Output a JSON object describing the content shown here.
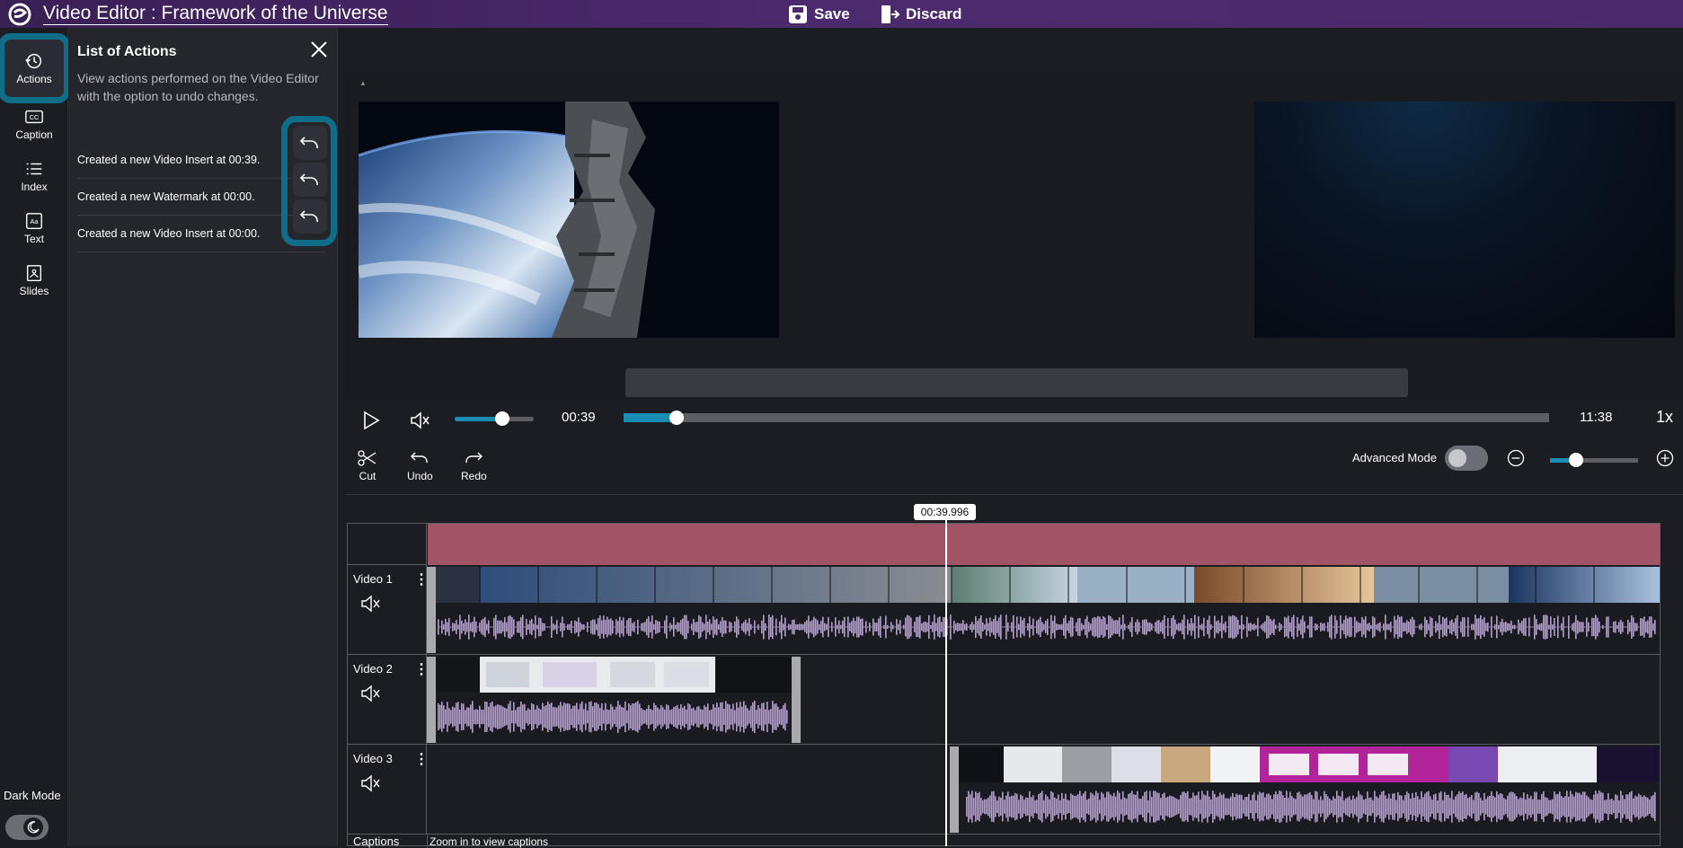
{
  "header": {
    "title": "Video Editor : Framework of the Universe",
    "save_label": "Save",
    "discard_label": "Discard"
  },
  "sidebar": {
    "items": [
      {
        "label": "Actions",
        "icon": "history-icon",
        "active": true
      },
      {
        "label": "Caption",
        "icon": "cc-icon"
      },
      {
        "label": "Index",
        "icon": "list-icon"
      },
      {
        "label": "Text",
        "icon": "text-icon"
      },
      {
        "label": "Slides",
        "icon": "slides-icon"
      }
    ],
    "dark_mode_label": "Dark Mode"
  },
  "actions_panel": {
    "title": "List of Actions",
    "description": "View actions performed on the Video Editor with the option to undo changes.",
    "actions": [
      "Created a new Video Insert at 00:39.",
      "Created a new Watermark at 00:00.",
      "Created a new Video Insert at 00:00."
    ]
  },
  "player": {
    "current_time": "00:39",
    "total_time": "11:38",
    "speed": "1x",
    "volume_level": 0.6,
    "progress": 0.057
  },
  "tools": {
    "cut": "Cut",
    "undo": "Undo",
    "redo": "Redo",
    "advanced_mode": "Advanced Mode",
    "zoom_level": 0.3
  },
  "timeline": {
    "playhead_time": "00:39.996",
    "tracks": [
      {
        "name": "Video 1"
      },
      {
        "name": "Video 2"
      },
      {
        "name": "Video 3"
      }
    ],
    "captions_label": "Captions",
    "captions_hint": "Zoom in to view captions"
  },
  "colors": {
    "accent": "#1a8db5",
    "highlight": "#0f6d8a",
    "ruler": "#a05466",
    "waveform": "#b89ad6"
  }
}
